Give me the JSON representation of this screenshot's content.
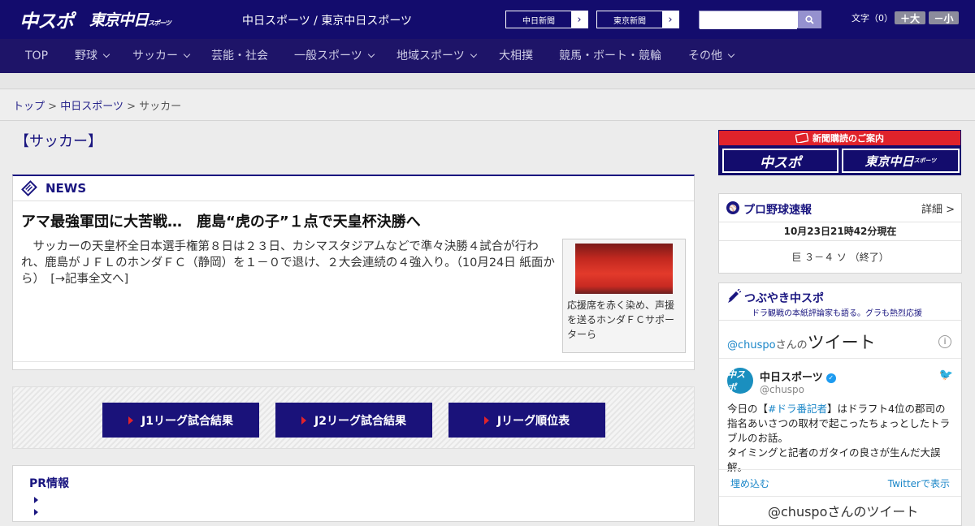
{
  "header": {
    "logo_primary": "中スポ",
    "logo_secondary": "東京中日",
    "logo_secondary_small": "スポーツ",
    "site_title": "中日スポーツ / 東京中日スポーツ",
    "link1": "中日新聞",
    "link2": "東京新聞",
    "search_placeholder": "",
    "font_label": "文字（0）",
    "font_bigger": "＋大",
    "font_smaller": "－小"
  },
  "nav": {
    "items": [
      {
        "label": "TOP",
        "dropdown": false
      },
      {
        "label": "野球",
        "dropdown": true
      },
      {
        "label": "サッカー",
        "dropdown": true
      },
      {
        "label": "芸能・社会",
        "dropdown": false
      },
      {
        "label": "一般スポーツ",
        "dropdown": true
      },
      {
        "label": "地域スポーツ",
        "dropdown": true
      },
      {
        "label": "大相撲",
        "dropdown": false
      },
      {
        "label": "競馬・ボート・競輪",
        "dropdown": false
      },
      {
        "label": "その他",
        "dropdown": true
      }
    ]
  },
  "breadcrumb": {
    "top": "トップ",
    "sep": ">",
    "chunichi": "中日スポーツ",
    "current": "サッカー"
  },
  "section_title": "【サッカー】",
  "news": {
    "label": "NEWS",
    "headline": "アマ最強軍団に大苦戦…　鹿島“虎の子”１点で天皇杯決勝へ",
    "body": "サッカーの天皇杯全日本選手権第８日は２３日、カシマスタジアムなどで準々決勝４試合が行われ、鹿島がＪＦＬのホンダＦＣ（静岡）を１－０で退け、２大会連続の４強入り。（10月24日 紙面から）　[→記事全文へ]",
    "photo_caption": "応援席を赤く染め、声援を送るホンダＦＣサポーターら"
  },
  "jleague": {
    "buttons": [
      "J1リーグ試合結果",
      "J2リーグ試合結果",
      "Jリーグ順位表"
    ]
  },
  "pr": {
    "label": "PR情報"
  },
  "subscription": {
    "title": "新聞購読のご案内",
    "logo1": "中スポ",
    "logo2": "東京中日",
    "logo2_small": "スポーツ"
  },
  "baseball": {
    "title": "プロ野球速報",
    "detail": "詳細 >",
    "time": "10月23日21時42分現在",
    "score": "巨 ３－４ ソ （終了）"
  },
  "tweets": {
    "title": "つぶやき中スポ",
    "subtitle": "ドラ観戦の本紙評論家も語る。グラも熱烈応援",
    "handle_link": "@chuspo",
    "handle_suffix": "さんの",
    "handle_title": "ツイート",
    "info": "i",
    "name": "中日スポーツ",
    "account": "@chuspo",
    "avatar": "中スポ",
    "text_prefix": "今日の【",
    "hashtag": "#ドラ番記者",
    "text_suffix": "】はドラフト4位の郡司の指名あいさつの取材で起こったちょっとしたトラブルのお話。\nタイミングと記者のガタイの良さが生んだ大誤解。",
    "embed": "埋め込む",
    "view_on_twitter": "Twitterで表示",
    "footer_handle": "@chuspoさんのツイート"
  }
}
